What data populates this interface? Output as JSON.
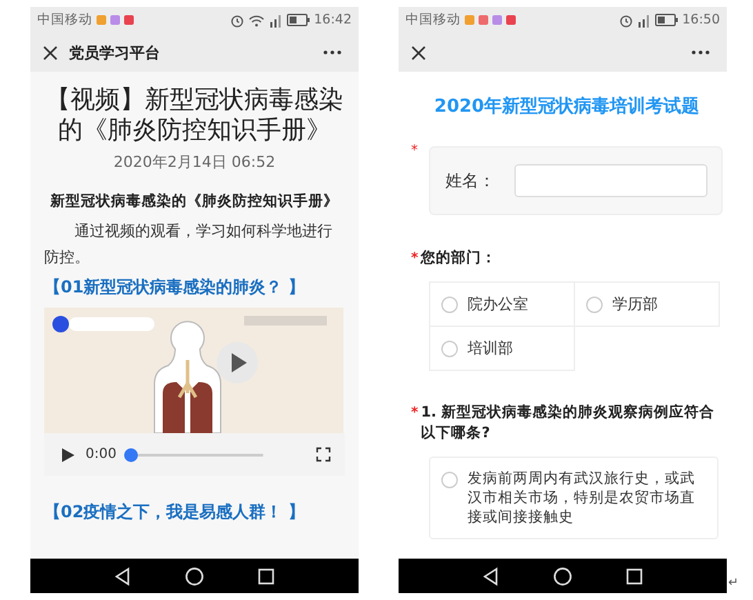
{
  "left_phone": {
    "status_bar": {
      "carrier": "中国移动",
      "notification_icons": [
        {
          "color": "#f0a030"
        },
        {
          "color": "#b98ce8"
        },
        {
          "color": "#e8434f"
        }
      ],
      "wifi": true,
      "time": "16:42"
    },
    "header": {
      "title": "党员学习平台"
    },
    "article": {
      "title": "【视频】新型冠状病毒感染的《肺炎防控知识手册》",
      "date": "2020年2月14日 06:52",
      "subtitle": "新型冠状病毒感染的《肺炎防控知识手册》",
      "paragraph": "通过视频的观看，学习如何科学地进行防控。",
      "sections": [
        {
          "heading": "【01新型冠状病毒感染的肺炎？ 】",
          "video": {
            "time": "0:00",
            "level": 0
          }
        },
        {
          "heading": "【02疫情之下，我是易感人群！ 】"
        }
      ]
    }
  },
  "right_phone": {
    "status_bar": {
      "carrier": "中国移动",
      "notification_icons": [
        {
          "color": "#f0a030"
        },
        {
          "color": "#ee6b6b"
        },
        {
          "color": "#b98ce8"
        },
        {
          "color": "#e8434f"
        }
      ],
      "time": "16:50"
    },
    "form": {
      "title": "2020年新型冠状病毒培训考试题",
      "questions": [
        {
          "kind": "text",
          "label": "姓名：",
          "required_mark": "*"
        },
        {
          "kind": "choice",
          "label": "您的部门：",
          "required_mark": "*",
          "options": [
            {
              "text": "院办公室",
              "selected": false
            },
            {
              "text": "学历部",
              "selected": false
            },
            {
              "text": "培训部",
              "selected": false
            }
          ]
        },
        {
          "kind": "list",
          "label": "1. 新型冠状病毒感染的肺炎观察病例应符合以下哪条?",
          "required_mark": "*",
          "options": [
            {
              "text": "发病前两周内有武汉旅行史，或武汉市相关市场，特别是农贸市场直接或间接接触史",
              "selected": false
            }
          ]
        }
      ]
    }
  },
  "trailing_mark": "↵"
}
